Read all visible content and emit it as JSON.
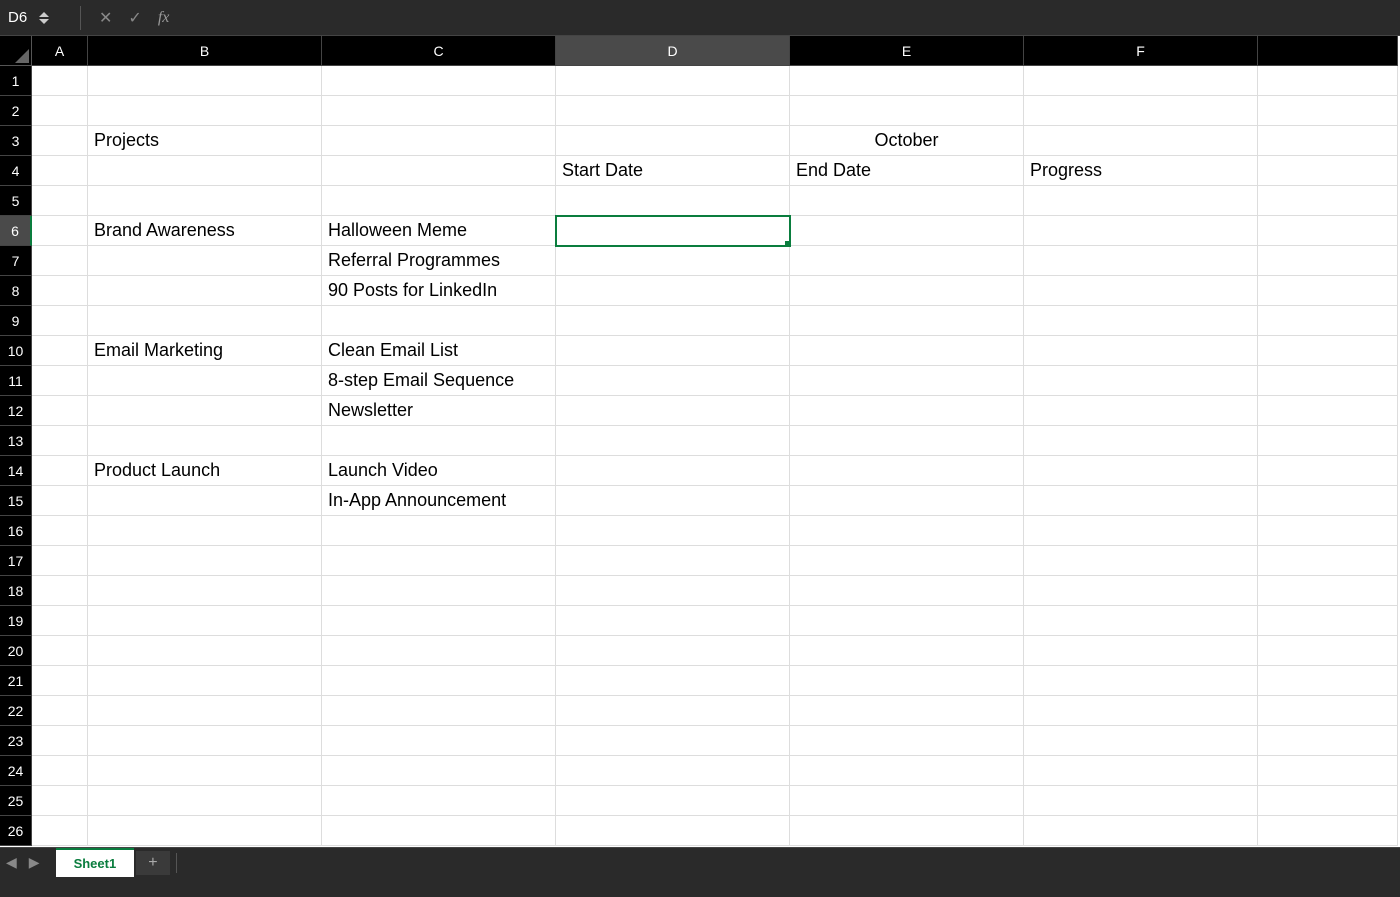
{
  "formulaBar": {
    "cellRef": "D6",
    "formula": ""
  },
  "columns": [
    "A",
    "B",
    "C",
    "D",
    "E",
    "F"
  ],
  "rowCount": 26,
  "activeCell": {
    "row": 6,
    "col": "D"
  },
  "activeColumn": "D",
  "activeRow": 6,
  "cells": {
    "B3": "Projects",
    "E3": "October",
    "D4": "Start Date",
    "E4": "End Date",
    "F4": "Progress",
    "B6": "Brand Awareness",
    "C6": "Halloween Meme",
    "C7": "Referral Programmes",
    "C8": "90 Posts for LinkedIn",
    "B10": "Email Marketing",
    "C10": "Clean Email List",
    "C11": "8-step Email Sequence",
    "C12": "Newsletter",
    "B14": "Product Launch",
    "C14": "Launch Video",
    "C15": "In-App Announcement"
  },
  "centeredCells": [
    "E3"
  ],
  "tabs": {
    "active": "Sheet1"
  }
}
